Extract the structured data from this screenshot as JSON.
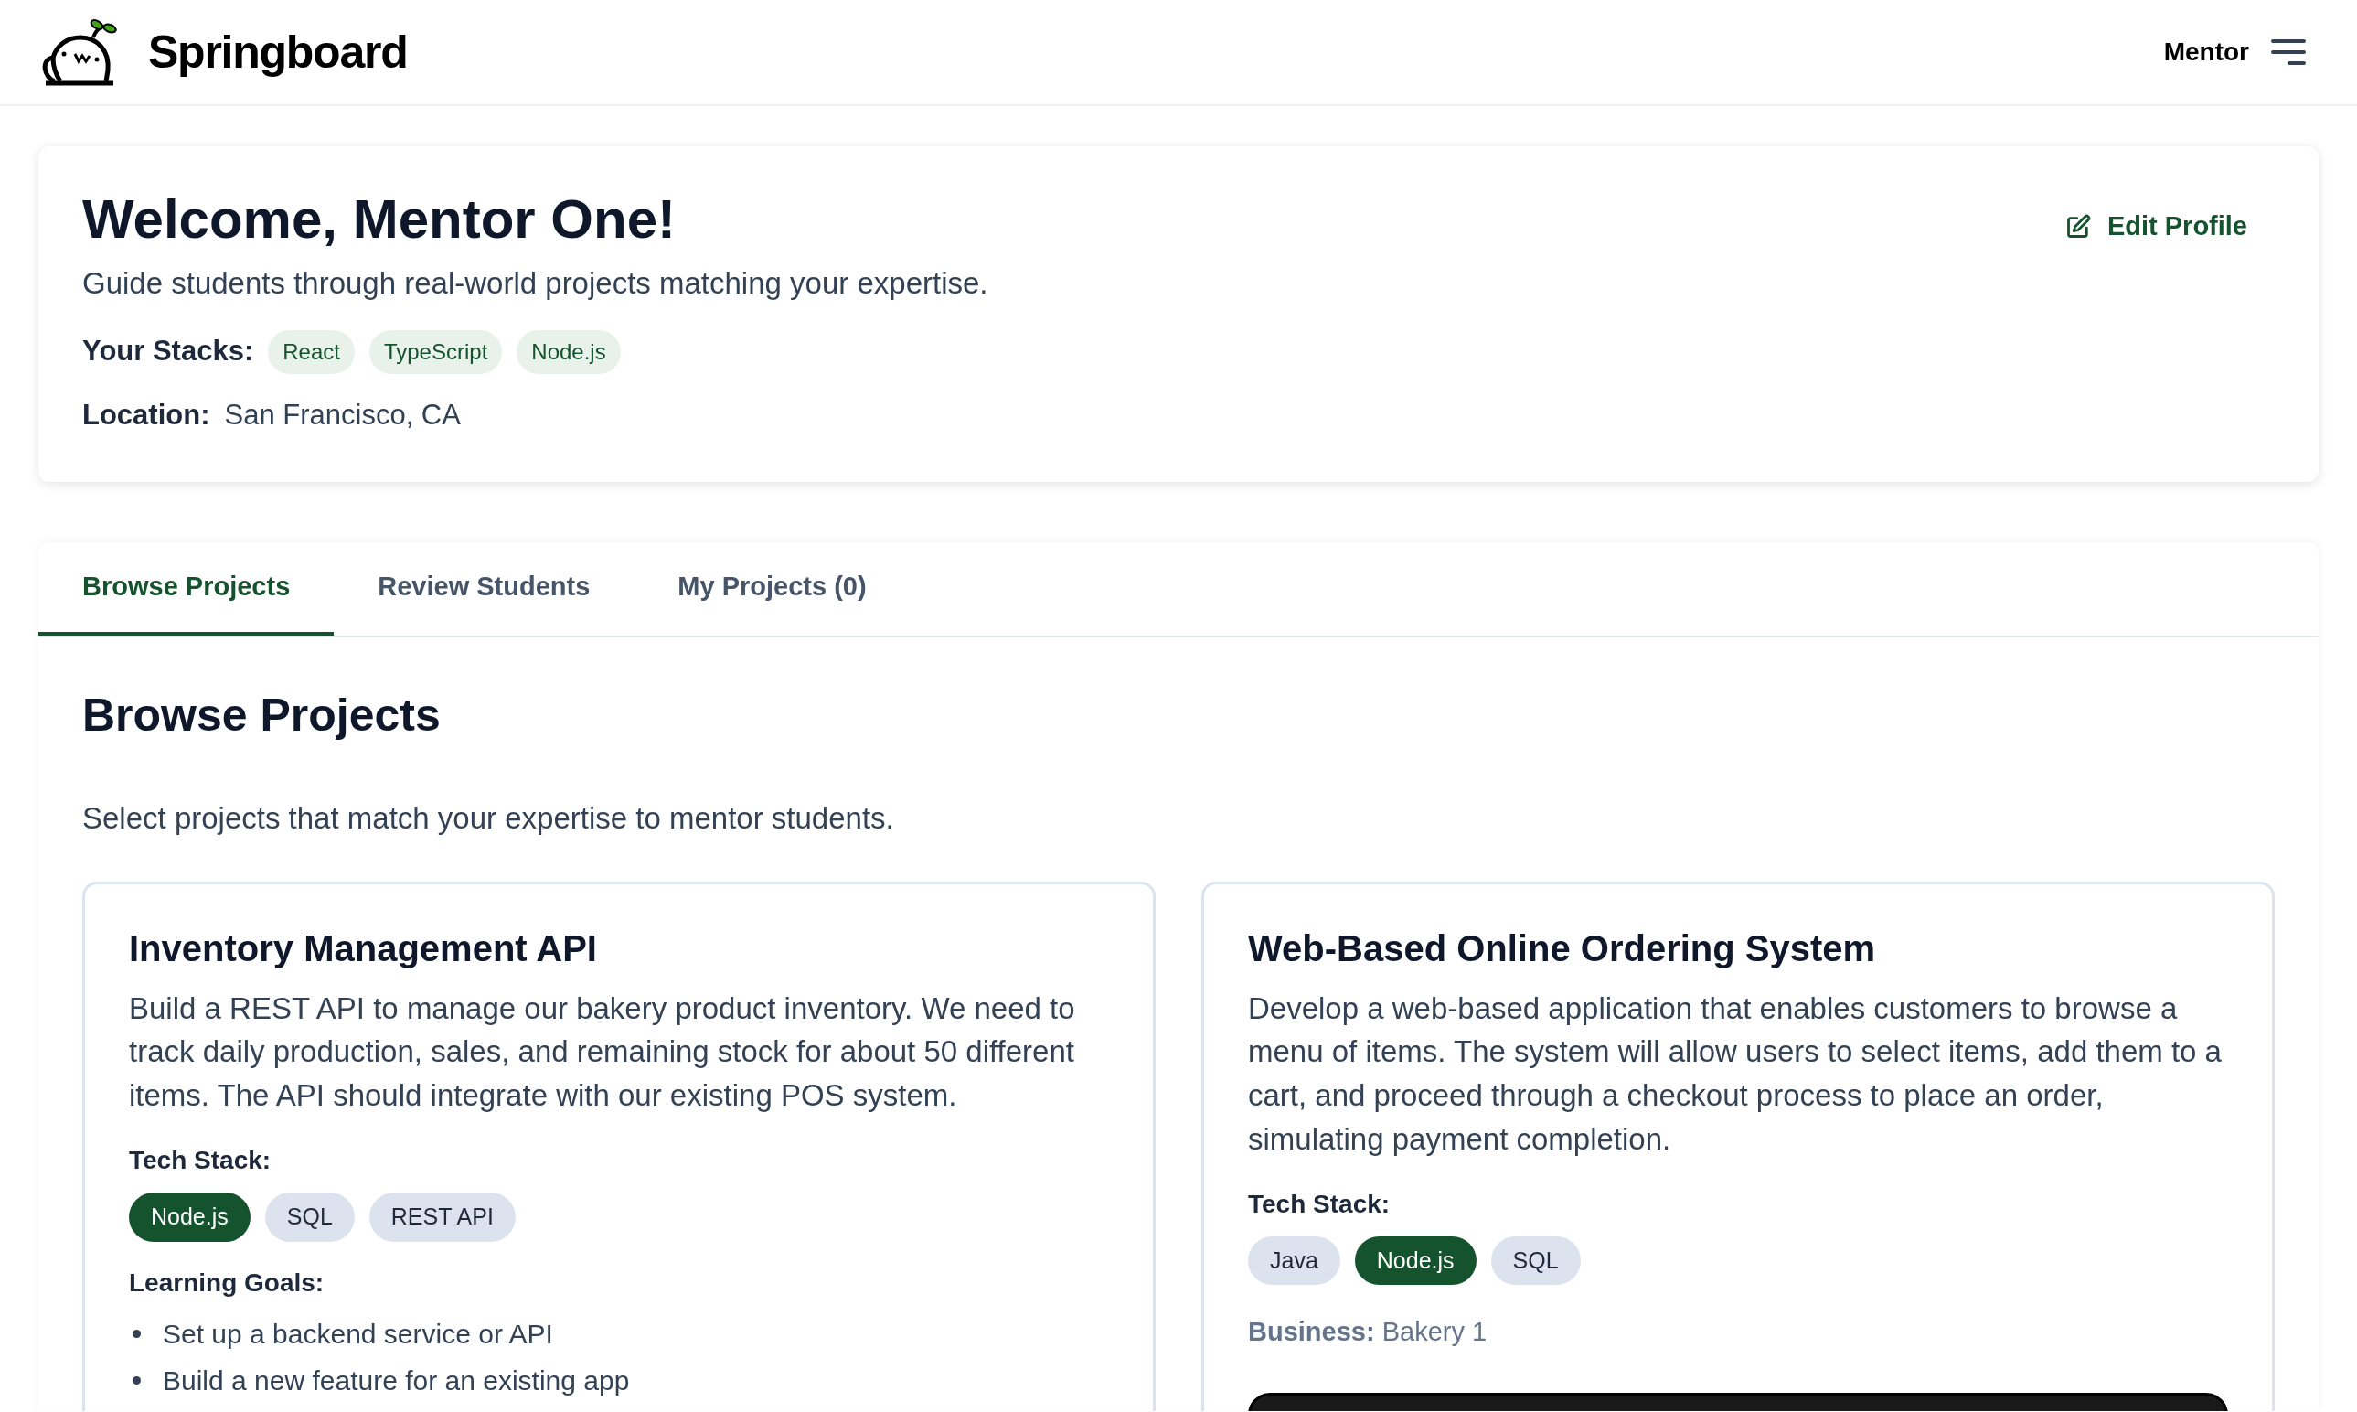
{
  "header": {
    "brand": "Springboard",
    "role": "Mentor"
  },
  "profile": {
    "title": "Welcome, Mentor One!",
    "subtitle": "Guide students through real-world projects matching your expertise.",
    "edit_label": "Edit Profile",
    "stacks_label": "Your Stacks:",
    "stacks": [
      "React",
      "TypeScript",
      "Node.js"
    ],
    "location_label": "Location:",
    "location": "San Francisco, CA"
  },
  "tabs": [
    {
      "label": "Browse Projects",
      "selected": true
    },
    {
      "label": "Review Students",
      "selected": false
    },
    {
      "label": "My Projects (0)",
      "selected": false
    }
  ],
  "section": {
    "title": "Browse Projects",
    "description": "Select projects that match your expertise to mentor students."
  },
  "projects": [
    {
      "title": "Inventory Management API",
      "description": "Build a REST API to manage our bakery product inventory. We need to track daily production, sales, and remaining stock for about 50 different items. The API should integrate with our existing POS system.",
      "tech_label": "Tech Stack:",
      "tech": [
        {
          "label": "Node.js",
          "highlighted": true
        },
        {
          "label": "SQL",
          "highlighted": false
        },
        {
          "label": "REST API",
          "highlighted": false
        }
      ],
      "goals_label": "Learning Goals:",
      "goals": [
        "Set up a backend service or API",
        "Build a new feature for an existing app"
      ]
    },
    {
      "title": "Web-Based Online Ordering System",
      "description": "Develop a web-based application that enables customers to browse a menu of items. The system will allow users to select items, add them to a cart, and proceed through a checkout process to place an order, simulating payment completion.",
      "tech_label": "Tech Stack:",
      "tech": [
        {
          "label": "Java",
          "highlighted": false
        },
        {
          "label": "Node.js",
          "highlighted": true
        },
        {
          "label": "SQL",
          "highlighted": false
        }
      ],
      "business_label": "Business:",
      "business": "Bakery 1",
      "has_action": true
    }
  ]
}
